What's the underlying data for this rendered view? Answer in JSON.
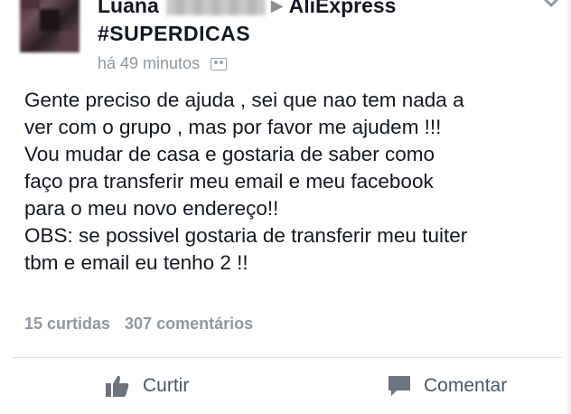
{
  "post": {
    "author_partial": "Luana",
    "group": "AliExpress",
    "hashtag": "#SUPERDICAS",
    "time": "há 49 minutos",
    "audience_icon": "friends-icon",
    "body_lines": [
      "Gente preciso de ajuda , sei que nao tem nada a",
      "ver com o grupo , mas por favor me ajudem !!!",
      "Vou mudar de casa e gostaria de saber como",
      "faço pra transferir meu email e meu facebook",
      "para o meu novo endereço!!",
      "OBS: se possivel gostaria de transferir meu tuiter",
      "tbm e email eu tenho 2 !!"
    ],
    "likes": "15 curtidas",
    "comments": "307 comentários"
  },
  "actions": {
    "like_label": "Curtir",
    "comment_label": "Comentar"
  },
  "colors": {
    "text": "#141823",
    "muted": "#9197a3",
    "action": "#4e5665"
  }
}
